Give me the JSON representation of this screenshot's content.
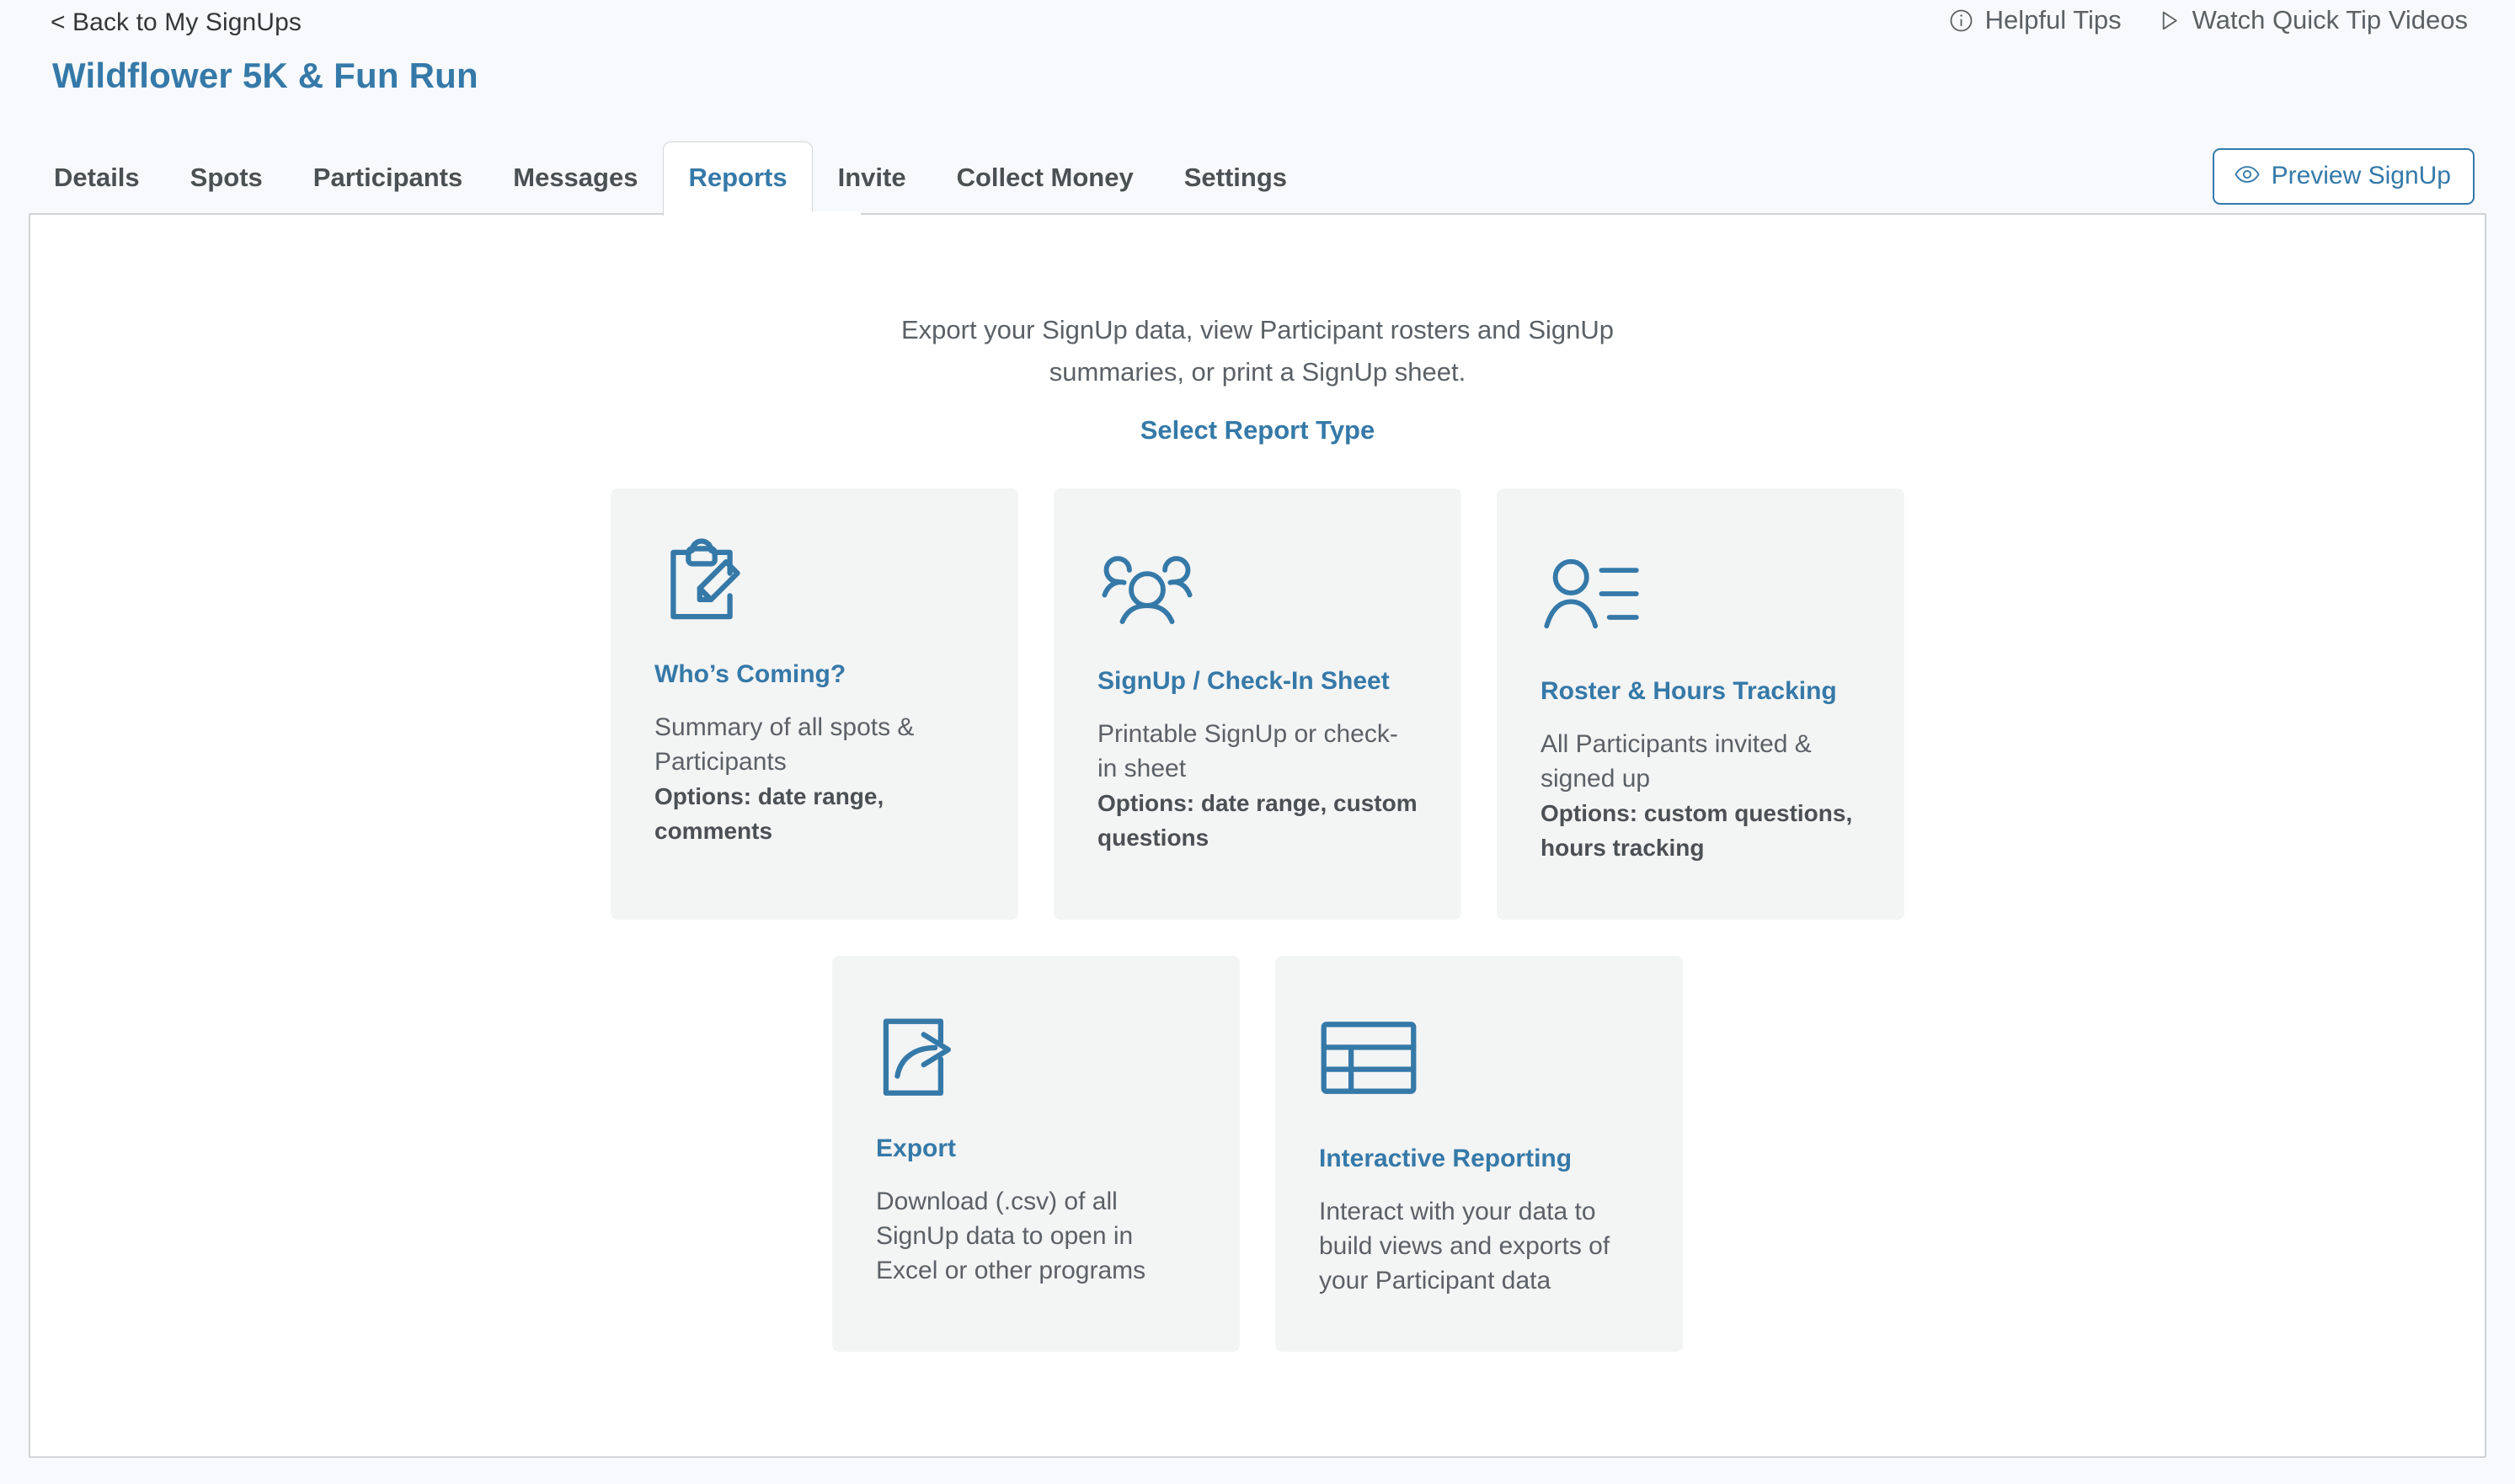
{
  "topbar": {
    "back_link": "< Back to My SignUps",
    "helpful_tips": "Helpful Tips",
    "watch_videos": "Watch Quick Tip Videos"
  },
  "header": {
    "title": "Wildflower 5K & Fun Run",
    "preview_button": "Preview SignUp"
  },
  "tabs": [
    {
      "label": "Details",
      "active": false
    },
    {
      "label": "Spots",
      "active": false
    },
    {
      "label": "Participants",
      "active": false
    },
    {
      "label": "Messages",
      "active": false
    },
    {
      "label": "Reports",
      "active": true
    },
    {
      "label": "Invite",
      "active": false
    },
    {
      "label": "Collect Money",
      "active": false
    },
    {
      "label": "Settings",
      "active": false
    }
  ],
  "main": {
    "intro_line1": "Export your SignUp data, view Participant rosters and SignUp",
    "intro_line2": "summaries, or print a SignUp sheet.",
    "select_report_type": "Select Report Type",
    "cards_row_1": [
      {
        "icon": "clipboard-pencil-icon",
        "title": "Who’s Coming?",
        "description": "Summary of all spots & Participants",
        "options": "Options: date range, comments"
      },
      {
        "icon": "people-group-icon",
        "title": "SignUp / Check-In Sheet",
        "description": "Printable SignUp or check-in sheet",
        "options": "Options: date range, custom questions"
      },
      {
        "icon": "person-list-icon",
        "title": "Roster & Hours Tracking",
        "description": "All Participants invited & signed up",
        "options": "Options: custom questions, hours tracking"
      }
    ],
    "cards_row_2": [
      {
        "icon": "export-share-icon",
        "title": "Export",
        "description": "Download (.csv) of all SignUp data to open in Excel or other programs",
        "options": ""
      },
      {
        "icon": "table-grid-icon",
        "title": "Interactive Reporting",
        "description": "Interact with your data to build views and exports of your Participant data",
        "options": ""
      }
    ]
  },
  "colors": {
    "accent_blue": "#3579a8",
    "page_background": "#f7f9fc",
    "card_background": "#f3f4f4",
    "body_text": "#5b6166"
  }
}
